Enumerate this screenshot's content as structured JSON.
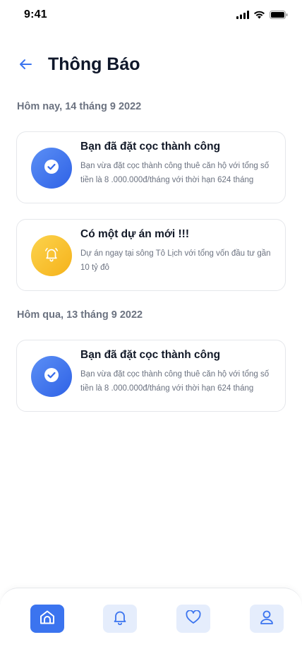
{
  "status_bar": {
    "time": "9:41"
  },
  "header": {
    "title": "Thông Báo"
  },
  "sections": [
    {
      "date": "Hôm nay, 14 tháng 9 2022",
      "notifications": [
        {
          "icon": "check-circle-icon",
          "title": "Bạn đã đặt cọc thành công",
          "body": "Bạn vừa đặt cọc thành công thuê căn hộ với tổng số tiền là 8 .000.000đ/tháng với thời hạn 624 tháng"
        },
        {
          "icon": "bell-icon",
          "title": "Có một dự án mới !!!",
          "body": "Dự án ngay tại sông Tô Lịch với tổng vốn đầu tư gần 10 tỷ đô"
        }
      ]
    },
    {
      "date": "Hôm qua, 13 tháng 9 2022",
      "notifications": [
        {
          "icon": "check-circle-icon",
          "title": "Bạn đã đặt cọc thành công",
          "body": "Bạn vừa đặt cọc thành công thuê căn hộ với tổng số tiền là 8 .000.000đ/tháng với thời hạn 624 tháng"
        }
      ]
    }
  ],
  "bottom_nav": {
    "items": [
      {
        "icon": "home-icon",
        "active": true
      },
      {
        "icon": "bell-icon",
        "active": false
      },
      {
        "icon": "heart-icon",
        "active": false
      },
      {
        "icon": "user-icon",
        "active": false
      }
    ]
  },
  "colors": {
    "accent": "#3b74ef",
    "accent_light": "#e5edfc",
    "warning": "#f5b21a",
    "muted_text": "#6b7280"
  }
}
